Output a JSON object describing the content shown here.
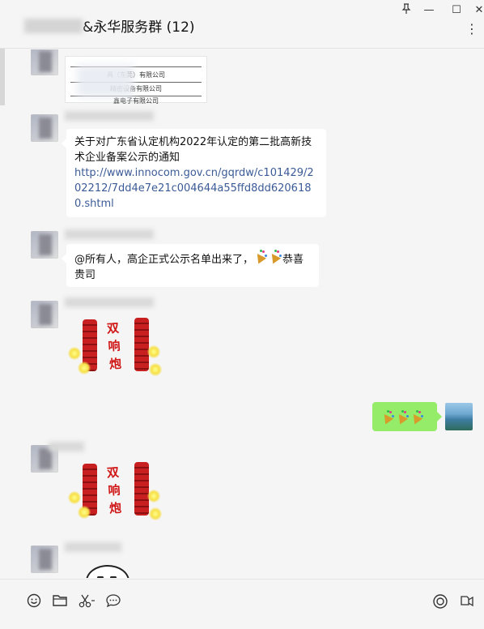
{
  "window": {
    "title_suffix": "&永华服务群 (12)",
    "pin_icon": "pin-icon",
    "minimize_label": "—",
    "maximize_label": "☐",
    "close_label": "✕",
    "more_label": "⋮"
  },
  "messages": {
    "doc_card": {
      "lines": [
        "具（东莞）有限公司",
        "精密设备有限公司",
        "鑫电子有限公司"
      ]
    },
    "notice": {
      "text": "关于对广东省认定机构2022年认定的第二批高新技术企业备案公示的通知",
      "link": "http://www.innocom.gov.cn/gqrdw/c101429/202212/7dd4e7e21c004644a55ffd8dd6206180.shtml"
    },
    "announce": {
      "text_before": "@所有人，高企正式公示名单出来了，",
      "text_after": "恭喜贵司"
    },
    "sticker_1": {
      "text": "双响炮"
    },
    "sticker_2": {
      "text": "双响炮"
    },
    "my_reply": {
      "emoji": "party-popper-icon"
    }
  },
  "toolbar": {
    "icons": [
      "emoji-icon",
      "folder-icon",
      "scissors-icon",
      "chat-bubble-icon",
      "record-icon",
      "video-call-icon"
    ]
  }
}
